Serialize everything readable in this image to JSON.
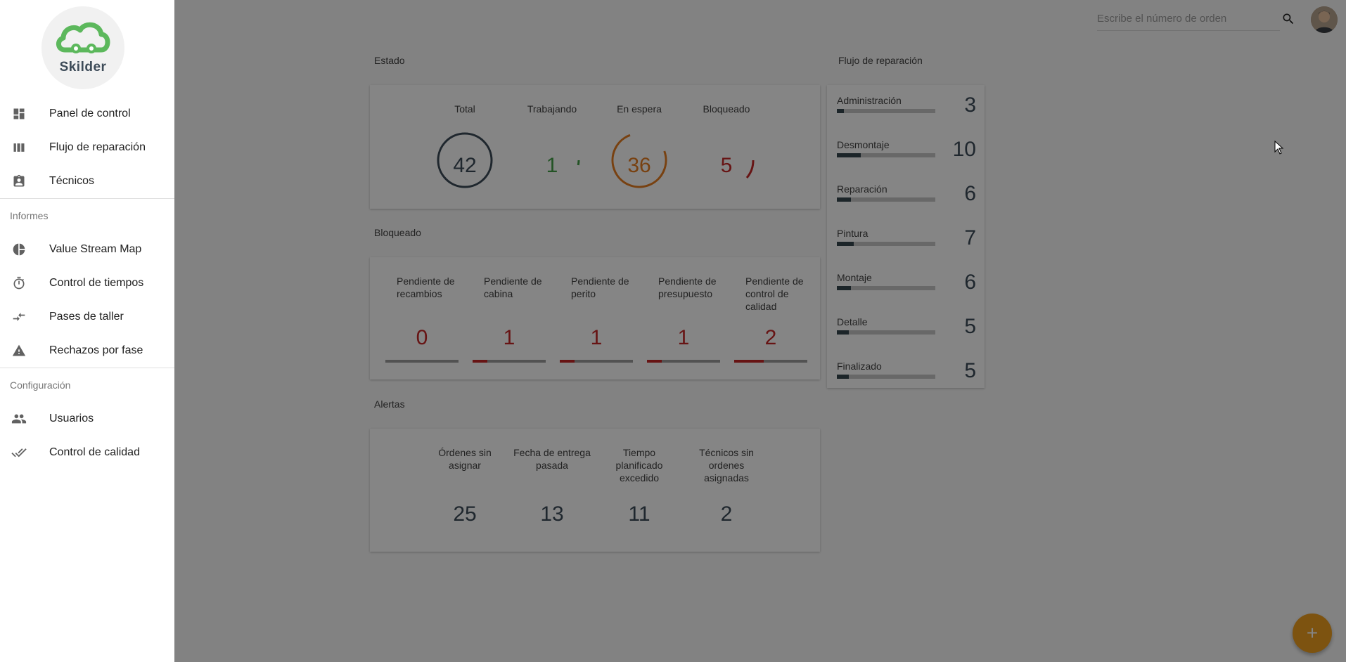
{
  "brand": {
    "name": "Skilder",
    "color": "#5cb85c"
  },
  "sidebar": {
    "items": [
      {
        "label": "Panel de control",
        "icon": "dashboard-icon"
      },
      {
        "label": "Flujo de reparación",
        "icon": "columns-icon"
      },
      {
        "label": "Técnicos",
        "icon": "badge-icon"
      }
    ],
    "section_reports": "Informes",
    "reports": [
      {
        "label": "Value Stream Map",
        "icon": "pie-chart-icon"
      },
      {
        "label": "Control de tiempos",
        "icon": "timer-icon"
      },
      {
        "label": "Pases de taller",
        "icon": "compare-arrows-icon"
      },
      {
        "label": "Rechazos por fase",
        "icon": "warning-icon"
      }
    ],
    "section_config": "Configuración",
    "config": [
      {
        "label": "Usuarios",
        "icon": "people-icon"
      },
      {
        "label": "Control de calidad",
        "icon": "done-all-icon"
      }
    ]
  },
  "topbar": {
    "search_placeholder": "Escribe el número de orden"
  },
  "estado": {
    "title": "Estado",
    "stats": [
      {
        "label": "Total",
        "value": "42",
        "color": "#3d4b58"
      },
      {
        "label": "Trabajando",
        "value": "1",
        "color": "#43a047"
      },
      {
        "label": "En espera",
        "value": "36",
        "color": "#e67e22"
      },
      {
        "label": "Bloqueado",
        "value": "5",
        "color": "#c62828"
      }
    ]
  },
  "bloqueado": {
    "title": "Bloqueado",
    "items": [
      {
        "label": "Pendiente de recambios",
        "value": "0",
        "fill": 0
      },
      {
        "label": "Pendiente de cabina",
        "value": "1",
        "fill": 0.2
      },
      {
        "label": "Pendiente de perito",
        "value": "1",
        "fill": 0.2
      },
      {
        "label": "Pendiente de presupuesto",
        "value": "1",
        "fill": 0.2
      },
      {
        "label": "Pendiente de control de calidad",
        "value": "2",
        "fill": 0.4
      }
    ]
  },
  "alertas": {
    "title": "Alertas",
    "items": [
      {
        "label": "Órdenes sin asignar",
        "value": "25"
      },
      {
        "label": "Fecha de entrega pasada",
        "value": "13"
      },
      {
        "label": "Tiempo planificado excedido",
        "value": "11"
      },
      {
        "label": "Técnicos sin ordenes asignadas",
        "value": "2"
      }
    ]
  },
  "flujo": {
    "title": "Flujo de reparación",
    "items": [
      {
        "label": "Administración",
        "value": "3",
        "fill": 0.07
      },
      {
        "label": "Desmontaje",
        "value": "10",
        "fill": 0.24
      },
      {
        "label": "Reparación",
        "value": "6",
        "fill": 0.14
      },
      {
        "label": "Pintura",
        "value": "7",
        "fill": 0.17
      },
      {
        "label": "Montaje",
        "value": "6",
        "fill": 0.14
      },
      {
        "label": "Detalle",
        "value": "5",
        "fill": 0.12
      },
      {
        "label": "Finalizado",
        "value": "5",
        "fill": 0.12
      }
    ]
  },
  "fab": {
    "label": "+"
  }
}
